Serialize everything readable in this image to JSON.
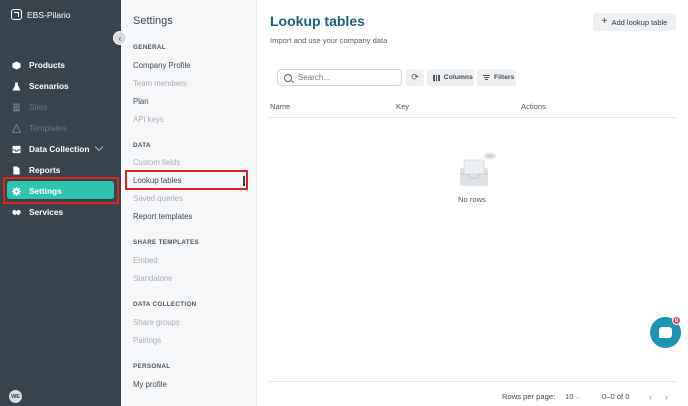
{
  "app": {
    "name": "EBS-Pilario"
  },
  "sidebar": {
    "items": [
      {
        "label": "Products",
        "icon": "cube-icon"
      },
      {
        "label": "Scenarios",
        "icon": "flask-icon"
      },
      {
        "label": "Sites",
        "icon": "building-icon"
      },
      {
        "label": "Templates",
        "icon": "template-icon"
      },
      {
        "label": "Data Collection",
        "icon": "inbox-icon"
      },
      {
        "label": "Reports",
        "icon": "document-icon"
      },
      {
        "label": "Settings",
        "icon": "gear-icon"
      },
      {
        "label": "Services",
        "icon": "handshake-icon"
      }
    ],
    "avatar_initials": "WE",
    "active": "Settings"
  },
  "settings": {
    "title": "Settings",
    "sections": {
      "general": "GENERAL",
      "data": "DATA",
      "share_templates": "SHARE TEMPLATES",
      "data_collection": "DATA COLLECTION",
      "personal": "PERSONAL"
    },
    "items": {
      "company_profile": "Company Profile",
      "team_members": "Team members",
      "plan": "Plan",
      "api_keys": "API keys",
      "custom_fields": "Custom fields",
      "lookup_tables": "Lookup tables",
      "saved_queries": "Saved queries",
      "report_templates": "Report templates",
      "embed": "Embed",
      "standalone": "Standalone",
      "share_groups": "Share groups",
      "pairings": "Pairings",
      "my_profile": "My profile"
    }
  },
  "main": {
    "title": "Lookup tables",
    "subtitle": "Import and use your company data",
    "add_button": "Add lookup table",
    "search_placeholder": "Search...",
    "columns_button": "Columns",
    "filters_button": "Filters",
    "headers": {
      "name": "Name",
      "key": "Key",
      "actions": "Actions"
    },
    "empty_text": "No rows",
    "footer": {
      "rows_per_page_label": "Rows per page:",
      "rows_per_page_value": "10",
      "range": "0–0 of 0"
    }
  },
  "chat": {
    "badge": "0"
  },
  "colors": {
    "accent": "#2ec4b0",
    "sidebar": "#37434d",
    "title": "#1d6076",
    "highlight": "#e2231a",
    "chat": "#1f93b3"
  }
}
